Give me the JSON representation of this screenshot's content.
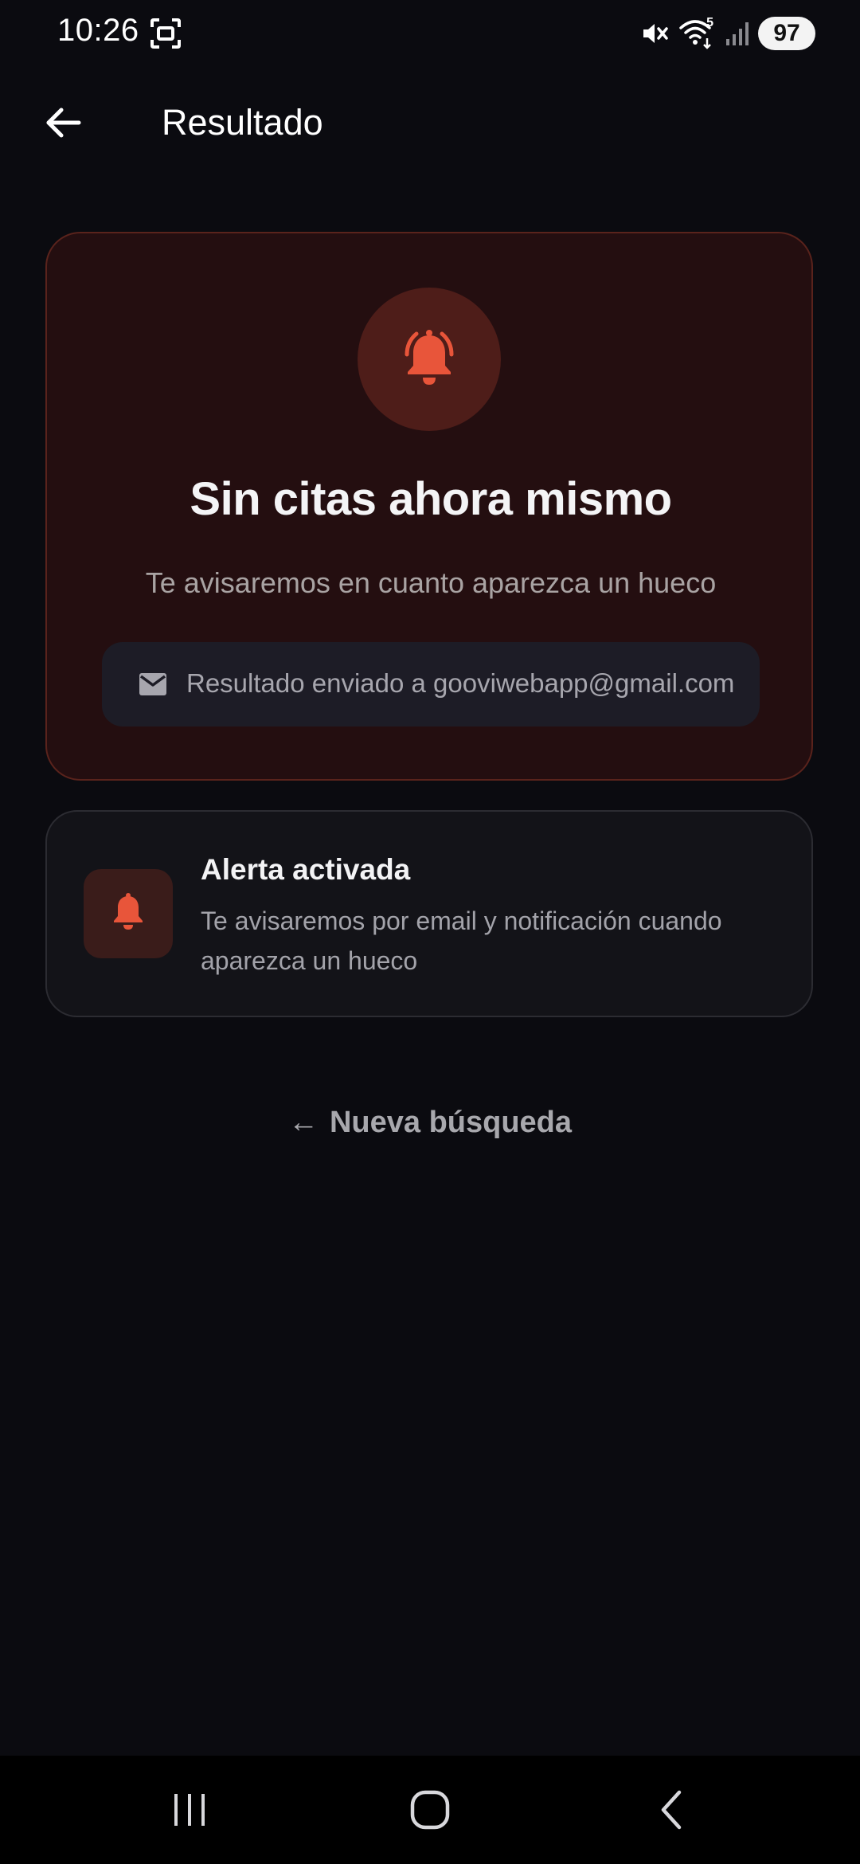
{
  "status_bar": {
    "time": "10:26",
    "battery": "97",
    "network": "5",
    "icons": [
      "screenshot-icon",
      "mute-icon",
      "wifi-icon",
      "signal-icon",
      "battery-icon"
    ]
  },
  "app_bar": {
    "title": "Resultado",
    "back_icon": "arrow-left-icon"
  },
  "result_card": {
    "icon": "bell-ringing-icon",
    "heading": "Sin citas ahora mismo",
    "subtitle": "Te avisaremos en cuanto aparezca un hueco",
    "email_icon": "mail-icon",
    "email_text": "Resultado enviado a gooviwebapp@gmail.com"
  },
  "alert_card": {
    "icon": "bell-icon",
    "title": "Alerta activada",
    "description": "Te avisaremos por email y notificación cuando aparezca un hueco"
  },
  "new_search": {
    "arrow": "←",
    "label": "Nueva búsqueda"
  },
  "nav_bar": {
    "items": [
      "recents-icon",
      "home-icon",
      "back-icon"
    ]
  },
  "colors": {
    "background": "#0b0b10",
    "accent": "#e8553a",
    "result_card_bg": "#240e10",
    "result_card_border": "#5a231c",
    "alert_card_bg": "#131318"
  }
}
